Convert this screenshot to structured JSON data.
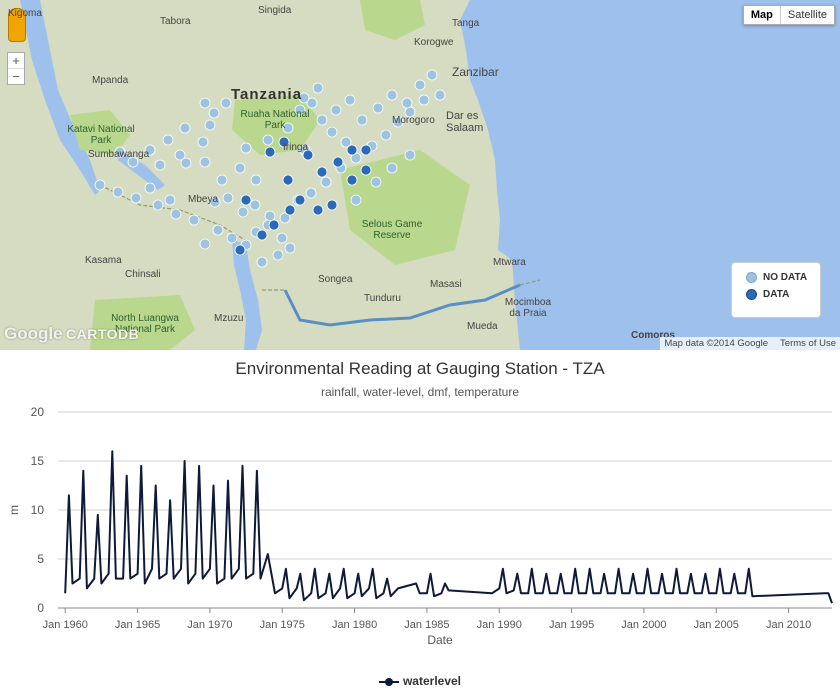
{
  "map": {
    "maptype_buttons": [
      "Map",
      "Satellite"
    ],
    "zoom_in": "+",
    "zoom_out": "−",
    "country_label": "Tanzania",
    "labels": [
      {
        "text": "Kigoma",
        "kind": "town"
      },
      {
        "text": "Tabora",
        "kind": "town"
      },
      {
        "text": "Singida",
        "kind": "town"
      },
      {
        "text": "Tanga",
        "kind": "town"
      },
      {
        "text": "Korogwe",
        "kind": "town"
      },
      {
        "text": "Zanzibar",
        "kind": "town"
      },
      {
        "text": "Mpanda",
        "kind": "town"
      },
      {
        "text": "Sumbawanga",
        "kind": "town"
      },
      {
        "text": "Kasama",
        "kind": "town"
      },
      {
        "text": "Chinsali",
        "kind": "town"
      },
      {
        "text": "Songea",
        "kind": "town"
      },
      {
        "text": "Tunduru",
        "kind": "town"
      },
      {
        "text": "Masasi",
        "kind": "town"
      },
      {
        "text": "Mtwara",
        "kind": "town"
      },
      {
        "text": "Mocimboa da Praia",
        "kind": "town"
      },
      {
        "text": "Mueda",
        "kind": "town"
      },
      {
        "text": "Mzuzu",
        "kind": "town"
      },
      {
        "text": "Mbeya",
        "kind": "town"
      },
      {
        "text": "Iringa",
        "kind": "town"
      },
      {
        "text": "Morogoro",
        "kind": "town"
      },
      {
        "text": "Dar es Salaam",
        "kind": "town"
      },
      {
        "text": "Comoros",
        "kind": "town"
      },
      {
        "text": "Ruaha National Park",
        "kind": "park"
      },
      {
        "text": "Katavi National Park",
        "kind": "park"
      },
      {
        "text": "Selous Game Reserve",
        "kind": "park"
      },
      {
        "text": "North Luangwa National Park",
        "kind": "park"
      }
    ],
    "legend": {
      "no_data": "NO DATA",
      "data": "DATA",
      "no_data_color": "#9cc4e0",
      "data_color": "#2a6ab8"
    },
    "attribution": {
      "map_data": "Map data ©2014 Google",
      "terms": "Terms of Use"
    },
    "google_logo": "Google",
    "cartodb_logo": "CARTODB"
  },
  "chart_data": {
    "type": "line",
    "title": "Environmental Reading at Gauging Station - TZA",
    "subtitle": "rainfall, water-level, dmf, temperature",
    "xlabel": "Date",
    "ylabel": "m",
    "ylim": [
      0,
      20
    ],
    "yticks": [
      0,
      5,
      10,
      15,
      20
    ],
    "xlim": [
      "1959-07-01",
      "2013-01-01"
    ],
    "xticks": [
      "Jan 1960",
      "Jan 1965",
      "Jan 1970",
      "Jan 1975",
      "Jan 1980",
      "Jan 1985",
      "Jan 1990",
      "Jan 1995",
      "Jan 2000",
      "Jan 2005",
      "Jan 2010"
    ],
    "grid": "horizontal",
    "legend_placement": "bottom-center",
    "series": [
      {
        "name": "waterlevel",
        "color": "#0d1a3a",
        "x": [
          "1960-01",
          "1960-04",
          "1960-07",
          "1961-01",
          "1961-04",
          "1961-07",
          "1962-01",
          "1962-04",
          "1962-07",
          "1963-01",
          "1963-04",
          "1963-07",
          "1964-01",
          "1964-04",
          "1964-07",
          "1965-01",
          "1965-04",
          "1965-07",
          "1966-01",
          "1966-04",
          "1966-07",
          "1967-01",
          "1967-04",
          "1967-07",
          "1968-01",
          "1968-04",
          "1968-07",
          "1969-01",
          "1969-04",
          "1969-07",
          "1970-01",
          "1970-04",
          "1970-07",
          "1971-01",
          "1971-04",
          "1971-07",
          "1972-01",
          "1972-04",
          "1972-07",
          "1973-01",
          "1973-04",
          "1973-07",
          "1974-01",
          "1974-04",
          "1974-07",
          "1975-01",
          "1975-04",
          "1975-07",
          "1976-01",
          "1976-04",
          "1976-07",
          "1977-01",
          "1977-04",
          "1977-07",
          "1978-01",
          "1978-04",
          "1978-07",
          "1979-01",
          "1979-04",
          "1979-07",
          "1980-01",
          "1980-04",
          "1980-07",
          "1981-01",
          "1981-04",
          "1981-07",
          "1982-01",
          "1982-04",
          "1982-07",
          "1983-01",
          "1984-04",
          "1984-07",
          "1985-01",
          "1985-04",
          "1985-07",
          "1986-01",
          "1986-04",
          "1986-07",
          "1989-07",
          "1990-01",
          "1990-04",
          "1990-07",
          "1991-01",
          "1991-04",
          "1991-07",
          "1992-01",
          "1992-04",
          "1992-07",
          "1993-01",
          "1993-04",
          "1993-07",
          "1994-01",
          "1994-04",
          "1994-07",
          "1995-01",
          "1995-04",
          "1995-07",
          "1996-01",
          "1996-04",
          "1996-07",
          "1997-01",
          "1997-04",
          "1997-07",
          "1998-01",
          "1998-04",
          "1998-07",
          "1999-01",
          "1999-04",
          "1999-07",
          "2000-01",
          "2000-04",
          "2000-07",
          "2001-01",
          "2001-04",
          "2001-07",
          "2002-01",
          "2002-04",
          "2002-07",
          "2003-01",
          "2003-04",
          "2003-07",
          "2004-01",
          "2004-04",
          "2004-07",
          "2005-01",
          "2005-04",
          "2005-07",
          "2006-01",
          "2006-04",
          "2006-07",
          "2007-01",
          "2007-04",
          "2007-07",
          "2012-07",
          "2012-10",
          "2013-01"
        ],
        "y": [
          1.5,
          11.5,
          2.5,
          3.0,
          14.0,
          2.0,
          3.0,
          9.5,
          2.5,
          3.5,
          16.0,
          3.0,
          3.0,
          13.5,
          3.0,
          3.5,
          14.5,
          2.5,
          4.0,
          12.5,
          3.0,
          3.5,
          11.0,
          3.0,
          4.0,
          15.0,
          2.5,
          3.5,
          14.5,
          3.0,
          4.0,
          12.5,
          2.5,
          3.0,
          13.0,
          3.0,
          4.0,
          14.5,
          3.0,
          3.5,
          14.0,
          3.0,
          5.5,
          3.5,
          1.5,
          2.0,
          4.0,
          1.0,
          2.0,
          3.5,
          0.8,
          1.5,
          4.0,
          1.0,
          1.5,
          3.5,
          1.0,
          2.0,
          4.0,
          1.0,
          1.5,
          3.5,
          1.2,
          2.0,
          4.0,
          1.0,
          1.5,
          3.0,
          1.2,
          2.0,
          2.5,
          1.5,
          1.5,
          3.5,
          1.2,
          1.5,
          2.5,
          1.8,
          1.5,
          2.0,
          4.0,
          1.5,
          1.8,
          3.5,
          1.5,
          1.5,
          4.0,
          1.5,
          1.5,
          3.5,
          1.5,
          1.5,
          3.5,
          1.5,
          1.5,
          4.0,
          1.5,
          1.5,
          4.0,
          1.5,
          1.5,
          3.5,
          1.5,
          1.5,
          4.0,
          1.5,
          1.5,
          3.5,
          1.5,
          1.5,
          4.0,
          1.5,
          1.5,
          3.5,
          1.5,
          1.5,
          4.0,
          1.5,
          1.5,
          3.5,
          1.5,
          1.5,
          3.5,
          1.5,
          1.5,
          4.0,
          1.5,
          1.5,
          3.5,
          1.5,
          1.5,
          4.0,
          1.2,
          1.5,
          1.5,
          0.5
        ]
      }
    ]
  }
}
